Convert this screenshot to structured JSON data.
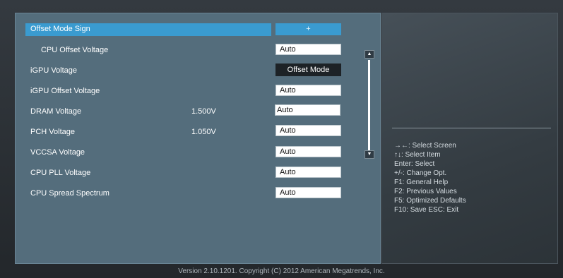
{
  "items": [
    {
      "label": "Offset Mode Sign",
      "value": "",
      "field": "+"
    },
    {
      "label": "CPU Offset Voltage",
      "value": "",
      "field": "Auto"
    },
    {
      "label": "iGPU Voltage",
      "value": "",
      "field": "Offset Mode"
    },
    {
      "label": "iGPU Offset Voltage",
      "value": "",
      "field": "Auto"
    },
    {
      "label": "DRAM Voltage",
      "value": "1.500V",
      "field": "Auto"
    },
    {
      "label": "PCH Voltage",
      "value": "1.050V",
      "field": "Auto"
    },
    {
      "label": "VCCSA Voltage",
      "value": "",
      "field": "Auto"
    },
    {
      "label": "CPU PLL Voltage",
      "value": "",
      "field": "Auto"
    },
    {
      "label": "CPU Spread Spectrum",
      "value": "",
      "field": "Auto"
    }
  ],
  "scroll": {
    "up_glyph": "▲",
    "down_glyph": "▼"
  },
  "help": [
    "→←: Select Screen",
    "↑↓: Select Item",
    "Enter: Select",
    "+/-: Change Opt.",
    "F1: General Help",
    "F2: Previous Values",
    "F5: Optimized Defaults",
    "F10: Save   ESC: Exit"
  ],
  "footer": "Version 2.10.1201. Copyright (C) 2012 American Megatrends, Inc.",
  "colors": {
    "panel": "#546d7c",
    "highlight": "#3a9bd0",
    "right_panel": "#3a4248",
    "field_dark": "#1d2226"
  }
}
